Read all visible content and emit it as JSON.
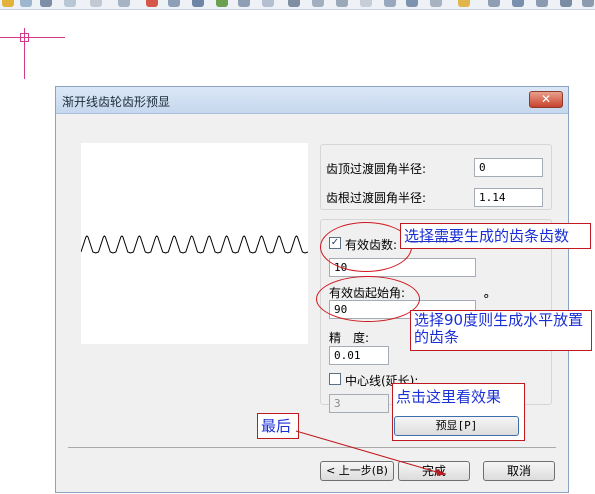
{
  "dialog": {
    "title": "渐开线齿轮齿形预显",
    "close_glyph": "✕",
    "fields": {
      "tip_fillet_label": "齿顶过渡圆角半径:",
      "tip_fillet_value": "0",
      "root_fillet_label": "齿根过渡圆角半径:",
      "root_fillet_value": "1.14",
      "teeth_count_label": "有效齿数:",
      "teeth_count_checked": true,
      "teeth_count_value": "10",
      "start_angle_label": "有效齿起始角:",
      "start_angle_value": "90",
      "degree_symbol": "°",
      "precision_label": "精　度:",
      "precision_value": "0.01",
      "centerline_label": "中心线(延长):",
      "centerline_checked": false,
      "centerline_value": "3"
    },
    "buttons": {
      "preview": "预显[P]",
      "back": "< 上一步(B)",
      "finish": "完成",
      "cancel": "取消"
    }
  },
  "annotations": {
    "select_teeth": "选择需要生成的齿条齿数",
    "select_90": "选择90度则生成水平放置",
    "select_90_line2": "的齿条",
    "click_preview": "点击这里看效果",
    "last": "最后"
  },
  "preview": {
    "shape": "rack-profile",
    "teeth": 13
  },
  "colors": {
    "annotation_border": "#c0191f",
    "annotation_text": "#1a2fd6",
    "cad_crosshair": "#d23a8c"
  }
}
